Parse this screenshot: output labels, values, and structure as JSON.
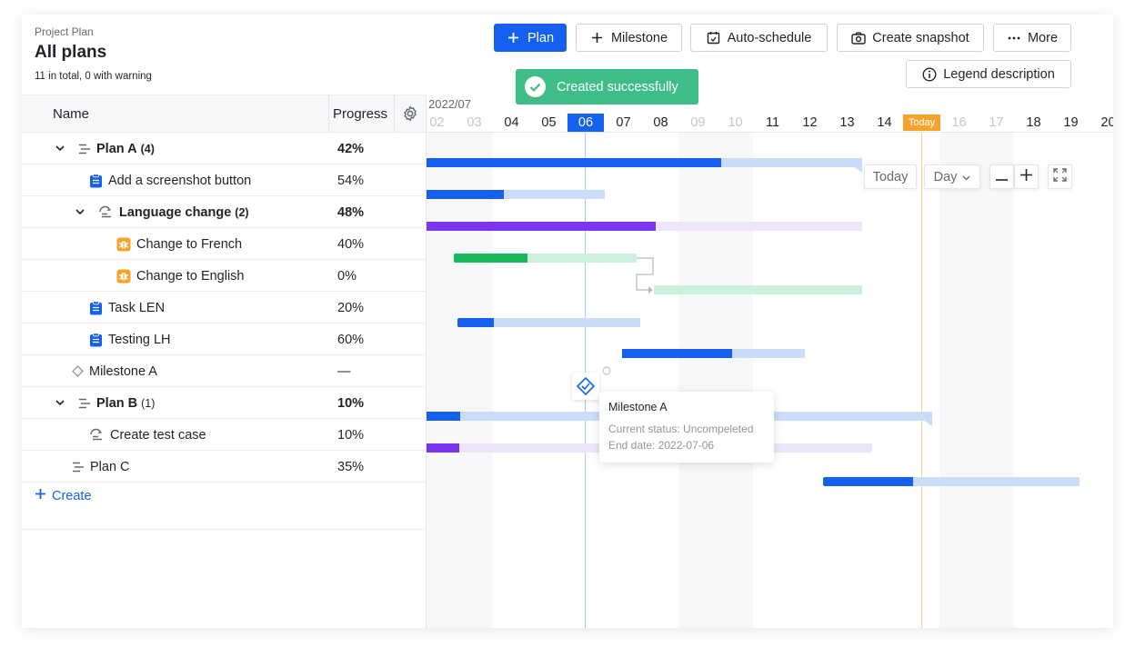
{
  "header": {
    "breadcrumb": "Project Plan",
    "title": "All plans",
    "summary": "11 in total, 0 with warning"
  },
  "toolbar": {
    "plan_label": "Plan",
    "milestone_label": "Milestone",
    "auto_schedule_label": "Auto-schedule",
    "snapshot_label": "Create snapshot",
    "more_label": "More",
    "legend_label": "Legend description"
  },
  "toast": {
    "text": "Created successfully"
  },
  "table": {
    "col_name": "Name",
    "col_progress": "Progress",
    "rows": [
      {
        "name": "Plan A",
        "count": "(4)",
        "progress": "42%",
        "type": "plan",
        "level": 0,
        "expanded": true
      },
      {
        "name": "Add a screenshot button",
        "count": "",
        "progress": "54%",
        "type": "task",
        "level": 1
      },
      {
        "name": "Language change",
        "count": "(2)",
        "progress": "48%",
        "type": "requirement",
        "level": 1,
        "expanded": true
      },
      {
        "name": "Change to French",
        "count": "",
        "progress": "40%",
        "type": "bug",
        "level": 2
      },
      {
        "name": "Change to English",
        "count": "",
        "progress": "0%",
        "type": "bug",
        "level": 2
      },
      {
        "name": "Task LEN",
        "count": "",
        "progress": "20%",
        "type": "task",
        "level": 1
      },
      {
        "name": "Testing LH",
        "count": "",
        "progress": "60%",
        "type": "task",
        "level": 1
      },
      {
        "name": "Milestone A",
        "count": "",
        "progress": "—",
        "type": "milestone",
        "level": 0
      },
      {
        "name": "Plan B",
        "count": "(1)",
        "progress": "10%",
        "type": "plan",
        "level": 0,
        "expanded": true
      },
      {
        "name": "Create test case",
        "count": "",
        "progress": "10%",
        "type": "requirement",
        "level": 1
      },
      {
        "name": "Plan C",
        "count": "",
        "progress": "35%",
        "type": "plan",
        "level": 0
      }
    ],
    "create_label": "Create"
  },
  "gantt": {
    "month": "2022/07",
    "days": [
      "02",
      "03",
      "04",
      "05",
      "06",
      "07",
      "08",
      "09",
      "10",
      "11",
      "12",
      "13",
      "14",
      "Today",
      "16",
      "17",
      "18",
      "19",
      "20"
    ],
    "selected_day": "06",
    "today_label": "Today",
    "controls": {
      "today": "Today",
      "scale": "Day"
    },
    "tooltip": {
      "title": "Milestone A",
      "status": "Current status: Uncompeleted",
      "end_date": "End date: 2022-07-06"
    },
    "colors": {
      "blue": "#1660f0",
      "blue_light": "#cadcf8",
      "purple": "#7b34f0",
      "purple_light": "#ede6fb",
      "green": "#19b85d",
      "green_light": "#cdf0dd",
      "today": "#f6a32c"
    }
  }
}
